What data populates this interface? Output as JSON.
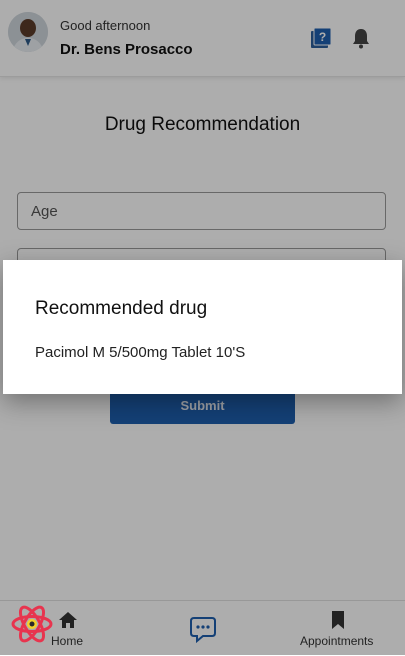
{
  "header": {
    "greeting": "Good afternoon",
    "doctor_name": "Dr. Bens Prosacco",
    "help_icon": "help-book-icon",
    "bell_icon": "bell-icon"
  },
  "main": {
    "title": "Drug Recommendation",
    "age_placeholder": "Age",
    "submit_label": "Submit"
  },
  "dialog": {
    "title": "Recommended drug",
    "drug": "Pacimol M 5/500mg Tablet 10'S"
  },
  "bottom_nav": {
    "home_label": "Home",
    "appointments_label": "Appointments"
  },
  "colors": {
    "primary": "#1e5fae",
    "scrim": "rgba(0,0,0,0.32)"
  }
}
